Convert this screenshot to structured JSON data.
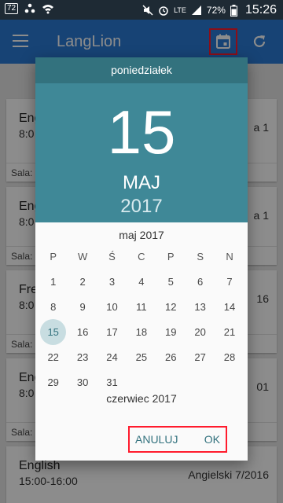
{
  "status_bar": {
    "left_box": "72",
    "network": "LTE",
    "battery": "72%",
    "time": "15:26"
  },
  "app_bar": {
    "title": "LangLion",
    "icons": [
      "menu-icon",
      "calendar-icon",
      "refresh-icon"
    ]
  },
  "cards": [
    {
      "lesson": "Engl",
      "hours": "8:0",
      "right": "a 1",
      "sala": "Sala:"
    },
    {
      "lesson": "Eng",
      "hours": "8:0",
      "right": "a 1",
      "sala": "Sala:"
    },
    {
      "lesson": "Fre",
      "hours": "8:0",
      "right": "16",
      "sala": "Sala:"
    },
    {
      "lesson": "Eng",
      "hours": "8:0",
      "right": "01",
      "sala": "Sala:"
    },
    {
      "lesson": "English",
      "hours": "15:00-16:00",
      "right": "Angielski 7/2016",
      "sala": ""
    }
  ],
  "date_picker": {
    "weekday": "poniedziałek",
    "day": "15",
    "month": "MAJ",
    "year": "2017",
    "month_title": "maj 2017",
    "next_month_title": "czerwiec 2017",
    "weekday_headers": [
      "P",
      "W",
      "Ś",
      "C",
      "P",
      "S",
      "N"
    ],
    "weeks": [
      [
        "1",
        "2",
        "3",
        "4",
        "5",
        "6",
        "7"
      ],
      [
        "8",
        "9",
        "10",
        "11",
        "12",
        "13",
        "14"
      ],
      [
        "15",
        "16",
        "17",
        "18",
        "19",
        "20",
        "21"
      ],
      [
        "22",
        "23",
        "24",
        "25",
        "26",
        "27",
        "28"
      ],
      [
        "29",
        "30",
        "31",
        "",
        "",
        "",
        ""
      ]
    ],
    "selected_day": "15",
    "cancel_label": "ANULUJ",
    "ok_label": "OK"
  },
  "colors": {
    "app_bar": "#2a7bd6",
    "dialog_header": "#3f8897",
    "dialog_weekday_bar": "#33727e",
    "accent": "#33727e",
    "highlight_box": "#ff1b2d"
  }
}
